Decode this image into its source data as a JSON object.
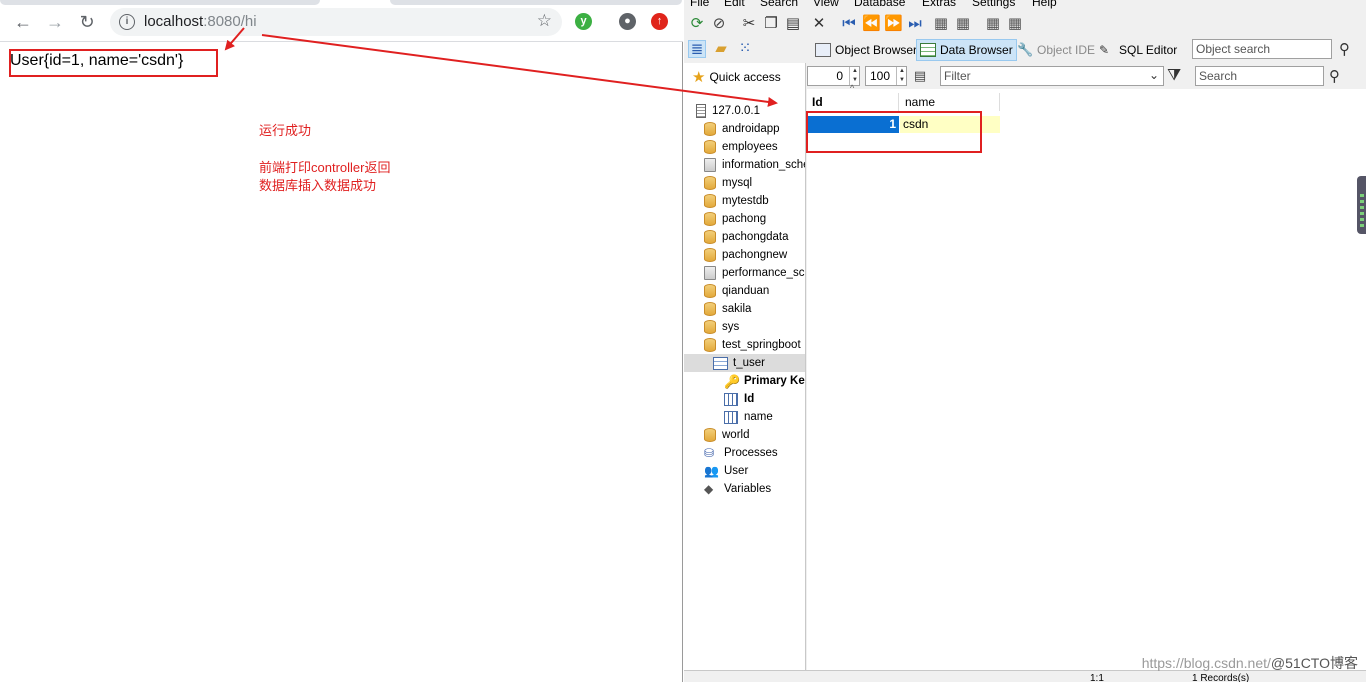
{
  "browser": {
    "url_host": "localhost",
    "url_rest": ":8080/hi",
    "page_output": "User{id=1, name='csdn'}",
    "icons": [
      "back-icon",
      "forward-icon",
      "reload-icon",
      "info-icon",
      "star-icon",
      "extension-icon",
      "profile-icon",
      "update-icon"
    ]
  },
  "notes": {
    "line1": "运行成功",
    "line2": "前端打印controller返回",
    "line3": "数据库插入数据成功"
  },
  "dbtool": {
    "menu": [
      "File",
      "Edit",
      "Search",
      "View",
      "Database",
      "Extras",
      "Settings",
      "Help"
    ],
    "tabs": {
      "object_browser": "Object Browser",
      "data_browser": "Data Browser",
      "object_ide": "Object IDE",
      "sql_editor": "SQL Editor"
    },
    "object_search_placeholder": "Object search",
    "quick_access": "Quick access",
    "offset": "0",
    "limit": "100",
    "filter_placeholder": "Filter",
    "search_placeholder": "Search",
    "tree": {
      "server": "127.0.0.1",
      "databases": [
        "androidapp",
        "employees",
        "information_sche",
        "mysql",
        "mytestdb",
        "pachong",
        "pachongdata",
        "pachongnew",
        "performance_sch",
        "qianduan",
        "sakila",
        "sys",
        "test_springboot"
      ],
      "table": "t_user",
      "primary_key": "Primary Ke",
      "columns": [
        "Id",
        "name"
      ],
      "after": [
        "world"
      ],
      "misc": [
        "Processes",
        "User",
        "Variables"
      ]
    },
    "grid": {
      "headers": [
        "Id",
        "name"
      ],
      "rows": [
        {
          "id": "1",
          "name": "csdn"
        }
      ]
    },
    "status": {
      "position": "1:1",
      "records": "1 Records(s)"
    },
    "watermark_url": "https://blog.csdn.net/",
    "watermark_brand": "@51CTO博客"
  }
}
